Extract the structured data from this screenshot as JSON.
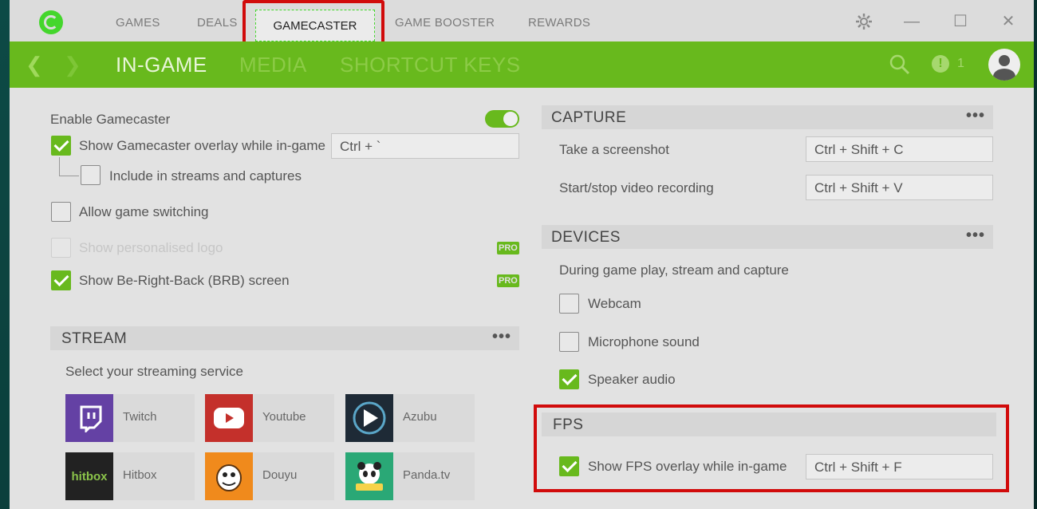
{
  "top_nav": {
    "games": "GAMES",
    "deals": "DEALS",
    "gamecaster": "GAMECASTER",
    "game_booster": "GAME BOOSTER",
    "rewards": "REWARDS"
  },
  "sub_nav": {
    "in_game": "IN-GAME",
    "media": "MEDIA",
    "shortcut_keys": "SHORTCUT KEYS"
  },
  "notifications": {
    "count": "1"
  },
  "window_controls": {
    "minimize": "—",
    "maximize": "☐",
    "close": "✕"
  },
  "left": {
    "enable_gamecaster": "Enable Gamecaster",
    "show_overlay": "Show Gamecaster overlay while in-game",
    "overlay_shortcut": "Ctrl + `",
    "include_streams": "Include in streams and captures",
    "allow_switching": "Allow game switching",
    "personalised_logo": "Show personalised logo",
    "brb_screen": "Show Be-Right-Back (BRB) screen",
    "pro_label": "PRO"
  },
  "stream": {
    "title": "STREAM",
    "menu": "•••",
    "select_label": "Select your streaming service",
    "services": [
      {
        "name": "Twitch",
        "icon": "twitch-icon",
        "color": "#6441a4"
      },
      {
        "name": "Youtube",
        "icon": "youtube-icon",
        "color": "#e52d27"
      },
      {
        "name": "Azubu",
        "icon": "azubu-icon",
        "color": "#1e2a36"
      },
      {
        "name": "Hitbox",
        "icon": "hitbox-icon",
        "color": "#222222"
      },
      {
        "name": "Douyu",
        "icon": "douyu-icon",
        "color": "#f08a1c"
      },
      {
        "name": "Panda.tv",
        "icon": "panda-icon",
        "color": "#2aa876"
      }
    ],
    "hitbox_logo": "hitbox"
  },
  "capture": {
    "title": "CAPTURE",
    "menu": "•••",
    "screenshot_label": "Take a screenshot",
    "screenshot_key": "Ctrl + Shift + C",
    "recording_label": "Start/stop video recording",
    "recording_key": "Ctrl + Shift + V"
  },
  "devices": {
    "title": "DEVICES",
    "menu": "•••",
    "description": "During game play, stream and capture",
    "webcam": "Webcam",
    "microphone": "Microphone sound",
    "speaker": "Speaker audio"
  },
  "fps": {
    "title": "FPS",
    "show_overlay": "Show FPS overlay while in-game",
    "shortcut": "Ctrl + Shift + F"
  },
  "colors": {
    "accent": "#68b91d",
    "highlight": "#d10b0b"
  }
}
